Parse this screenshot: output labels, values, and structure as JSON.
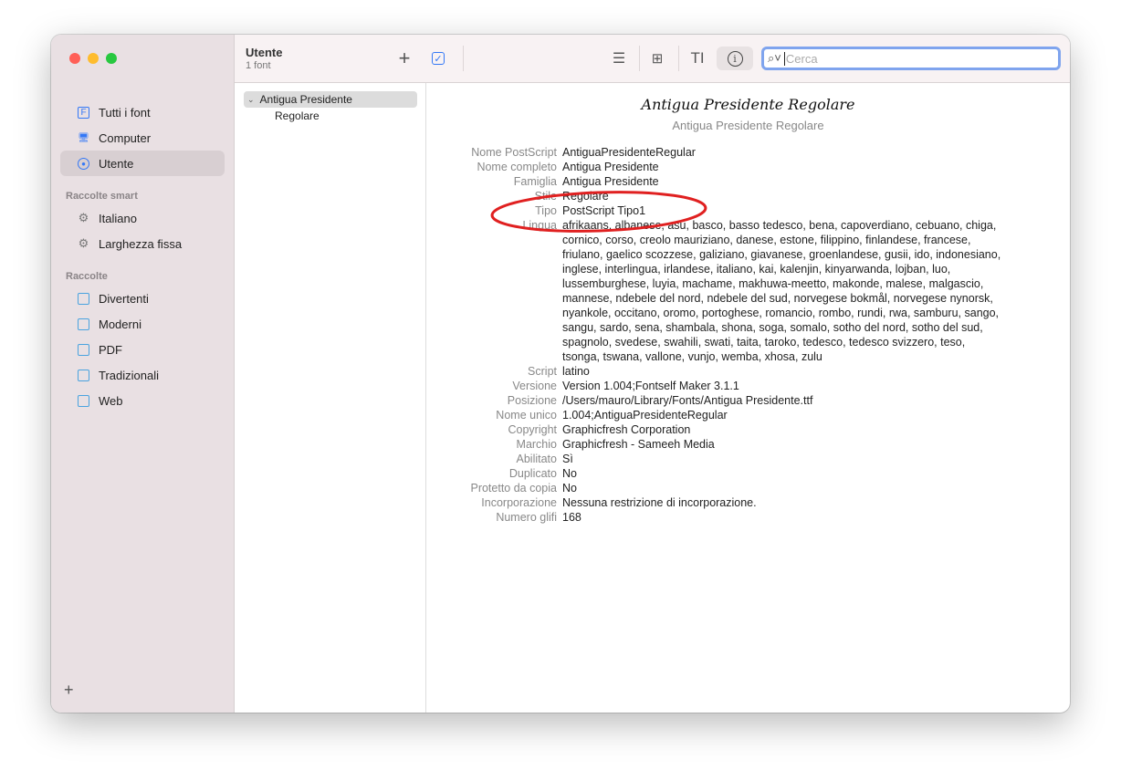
{
  "sidebar": {
    "items": [
      {
        "label": "Tutti i font",
        "icon": "font-book-icon"
      },
      {
        "label": "Computer",
        "icon": "computer-icon"
      },
      {
        "label": "Utente",
        "icon": "user-icon",
        "selected": true
      }
    ],
    "smart_header": "Raccolte smart",
    "smart": [
      {
        "label": "Italiano",
        "icon": "gear-icon"
      },
      {
        "label": "Larghezza fissa",
        "icon": "gear-icon"
      }
    ],
    "coll_header": "Raccolte",
    "collections": [
      {
        "label": "Divertenti"
      },
      {
        "label": "Moderni"
      },
      {
        "label": "PDF"
      },
      {
        "label": "Tradizionali"
      },
      {
        "label": "Web"
      }
    ],
    "add": "+"
  },
  "toolbar": {
    "title": "Utente",
    "subtitle": "1 font",
    "add": "+",
    "search_placeholder": "Cerca"
  },
  "fontlist": {
    "family": "Antigua Presidente",
    "style": "Regolare"
  },
  "preview": {
    "sample": "Antigua Presidente Regolare",
    "name": "Antigua Presidente Regolare"
  },
  "info": [
    {
      "label": "Nome PostScript",
      "value": "AntiguaPresidenteRegular"
    },
    {
      "label": "Nome completo",
      "value": "Antigua Presidente"
    },
    {
      "label": "Famiglia",
      "value": "Antigua Presidente"
    },
    {
      "label": "Stile",
      "value": "Regolare"
    },
    {
      "label": "Tipo",
      "value": "PostScript Tipo1"
    },
    {
      "label": "Lingua",
      "lines": [
        "afrikaans, albanese, asu, basco, basso tedesco, bena, capoverdiano, cebuano, chiga,",
        "cornico, corso, creolo mauriziano, danese, estone, filippino, finlandese, francese,",
        "friulano, gaelico scozzese, galiziano, giavanese, groenlandese, gusii, ido, indonesiano,",
        "inglese, interlingua, irlandese, italiano, kai, kalenjin, kinyarwanda, lojban, luo,",
        "lussemburghese, luyia, machame, makhuwa-meetto, makonde, malese, malgascio,",
        "mannese, ndebele del nord, ndebele del sud, norvegese bokmål, norvegese nynorsk,",
        "nyankole, occitano, oromo, portoghese, romancio, rombo, rundi, rwa, samburu, sango,",
        "sangu, sardo, sena, shambala, shona, soga, somalo, sotho del nord, sotho del sud,",
        "spagnolo, svedese, swahili, swati, taita, taroko, tedesco, tedesco svizzero, teso,",
        "tsonga, tswana, vallone, vunjo, wemba, xhosa, zulu"
      ]
    },
    {
      "label": "Script",
      "value": "latino"
    },
    {
      "label": "Versione",
      "value": "Version 1.004;Fontself Maker 3.1.1"
    },
    {
      "label": "Posizione",
      "value": "/Users/mauro/Library/Fonts/Antigua Presidente.ttf"
    },
    {
      "label": "Nome unico",
      "value": "1.004;AntiguaPresidenteRegular"
    },
    {
      "label": "Copyright",
      "value": "Graphicfresh Corporation"
    },
    {
      "label": "Marchio",
      "value": "Graphicfresh - Sameeh Media"
    },
    {
      "label": "Abilitato",
      "value": "Sì"
    },
    {
      "label": "Duplicato",
      "value": "No"
    },
    {
      "label": "Protetto da copia",
      "value": "No"
    },
    {
      "label": "Incorporazione",
      "value": "Nessuna restrizione di incorporazione."
    },
    {
      "label": "Numero glifi",
      "value": "168"
    }
  ],
  "colors": {
    "accent": "#3478f6",
    "highlight": "#e02020"
  }
}
